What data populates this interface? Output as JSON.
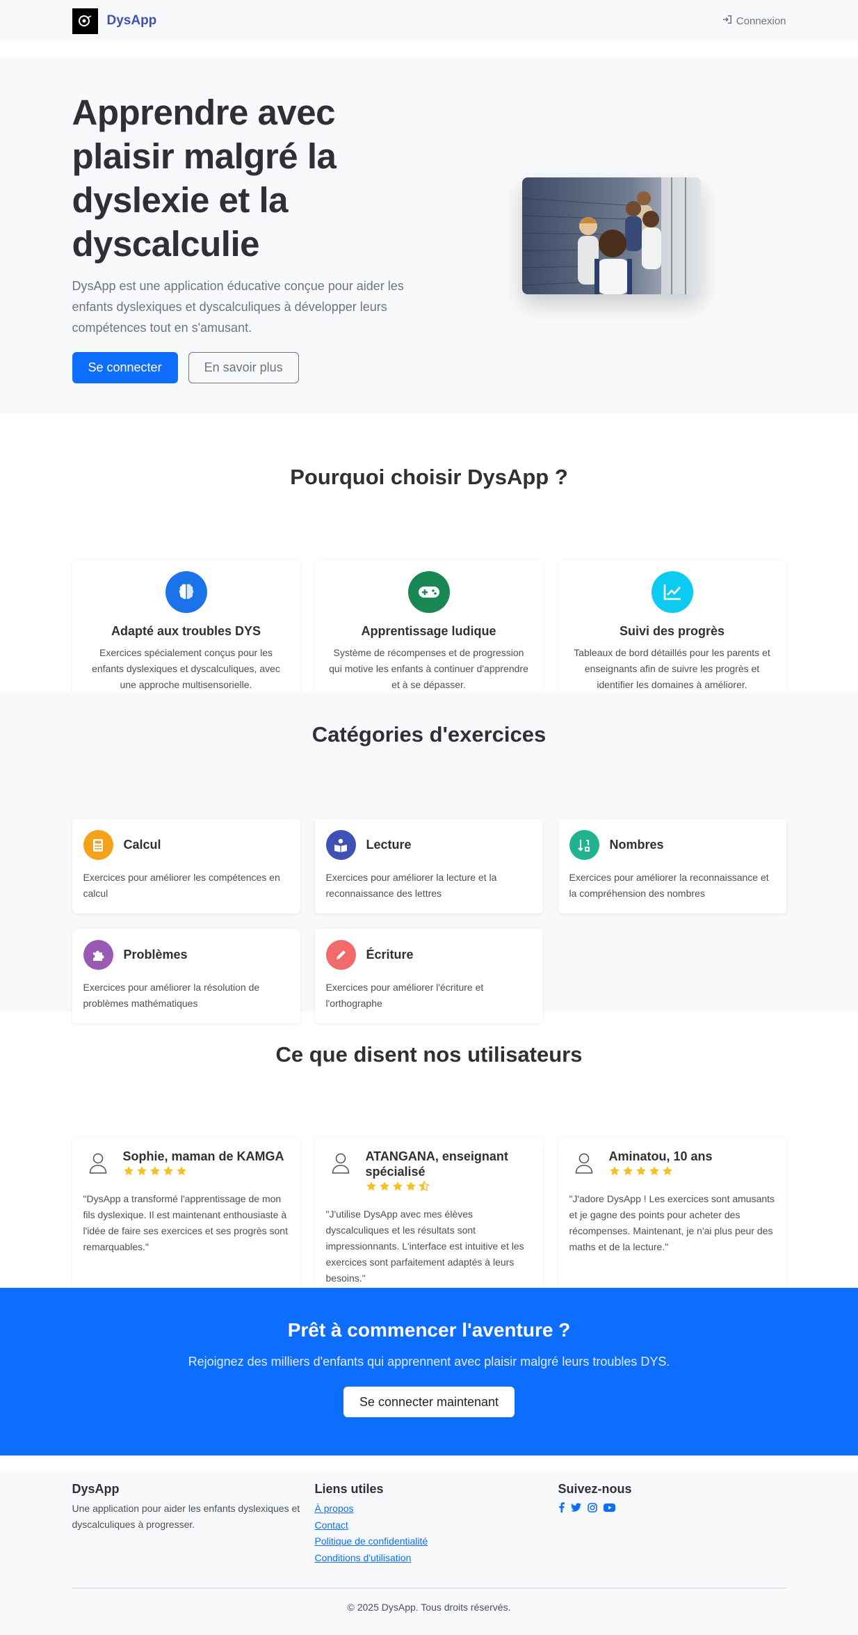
{
  "navbar": {
    "brand": "DysApp",
    "login_label": "Connexion"
  },
  "hero": {
    "title": "Apprendre avec plaisir malgré la dyslexie et la dyscalculie",
    "text": "DysApp est une application éducative conçue pour aider les enfants dyslexiques et dyscalculiques à développer leurs compétences tout en s'amusant.",
    "primary_button": "Se connecter",
    "secondary_button": "En savoir plus"
  },
  "why": {
    "title": "Pourquoi choisir DysApp ?",
    "features": [
      {
        "icon": "brain-icon",
        "color": "#1a73e8",
        "title": "Adapté aux troubles DYS",
        "text": "Exercices spécialement conçus pour les enfants dyslexiques et dyscalculiques, avec une approche multisensorielle."
      },
      {
        "icon": "gamepad-icon",
        "color": "#198754",
        "title": "Apprentissage ludique",
        "text": "Système de récompenses et de progression qui motive les enfants à continuer d'apprendre et à se dépasser."
      },
      {
        "icon": "chart-line-icon",
        "color": "#0dcaf0",
        "title": "Suivi des progrès",
        "text": "Tableaux de bord détaillés pour les parents et enseignants afin de suivre les progrès et identifier les domaines à améliorer."
      }
    ]
  },
  "categories": {
    "title": "Catégories d'exercices",
    "items": [
      {
        "icon": "calculator-icon",
        "color": "#f4a11c",
        "name": "Calcul",
        "text": "Exercices pour améliorer les compétences en calcul"
      },
      {
        "icon": "book-reader-icon",
        "color": "#3f51b5",
        "name": "Lecture",
        "text": "Exercices pour améliorer la lecture et la reconnaissance des lettres"
      },
      {
        "icon": "sort-numbers-icon",
        "color": "#20b38f",
        "name": "Nombres",
        "text": "Exercices pour améliorer la reconnaissance et la compréhension des nombres"
      },
      {
        "icon": "puzzle-icon",
        "color": "#9b59b6",
        "name": "Problèmes",
        "text": "Exercices pour améliorer la résolution de problèmes mathématiques"
      },
      {
        "icon": "pencil-icon",
        "color": "#f16b6b",
        "name": "Écriture",
        "text": "Exercices pour améliorer l'écriture et l'orthographe"
      }
    ]
  },
  "testimonials": {
    "title": "Ce que disent nos utilisateurs",
    "star_color": "#f6c023",
    "items": [
      {
        "name": "Sophie, maman de KAMGA",
        "rating": 5,
        "text": "\"DysApp a transformé l'apprentissage de mon fils dyslexique. Il est maintenant enthousiaste à l'idée de faire ses exercices et ses progrès sont remarquables.\""
      },
      {
        "name": "ATANGANA, enseignant spécialisé",
        "rating": 4.5,
        "text": "\"J'utilise DysApp avec mes élèves dyscalculiques et les résultats sont impressionnants. L'interface est intuitive et les exercices sont parfaitement adaptés à leurs besoins.\""
      },
      {
        "name": "Aminatou, 10 ans",
        "rating": 5,
        "text": "\"J'adore DysApp ! Les exercices sont amusants et je gagne des points pour acheter des récompenses. Maintenant, je n'ai plus peur des maths et de la lecture.\""
      }
    ]
  },
  "cta": {
    "title": "Prêt à commencer l'aventure ?",
    "text": "Rejoignez des milliers d'enfants qui apprennent avec plaisir malgré leurs troubles DYS.",
    "button": "Se connecter maintenant"
  },
  "footer": {
    "brand": "DysApp",
    "brand_text": "Une application pour aider les enfants dyslexiques et dyscalculiques à progresser.",
    "links_title": "Liens utiles",
    "links": [
      "À propos",
      "Contact",
      "Politique de confidentialité",
      "Conditions d'utilisation"
    ],
    "social_title": "Suivez-nous",
    "social_icons": [
      "facebook-icon",
      "twitter-icon",
      "instagram-icon",
      "youtube-icon"
    ],
    "copyright": "© 2025 DysApp. Tous droits réservés."
  },
  "colors": {
    "primary": "#0d6efd",
    "brand": "#3f51b5",
    "light_bg": "#f8f9fa"
  }
}
